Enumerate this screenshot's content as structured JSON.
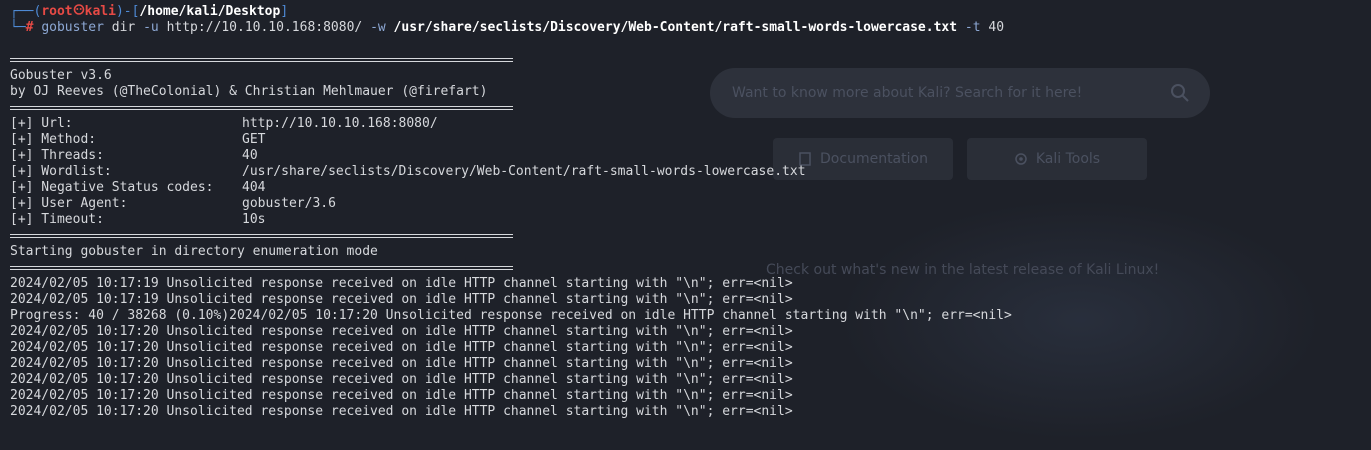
{
  "background": {
    "search_placeholder": "Want to know more about Kali? Search for it here!",
    "docs_button": "Documentation",
    "tools_button": "Kali Tools",
    "tagline": "Check out what's new in the latest release of Kali Linux!"
  },
  "prompt": {
    "user": "root",
    "host": "kali",
    "path": "/home/kali/Desktop",
    "symbol": "#"
  },
  "command": {
    "program": "gobuster",
    "subcommand": "dir",
    "flag_u": "-u",
    "url": "http://10.10.10.168:8080/",
    "flag_w": "-w",
    "wordlist": "/usr/share/seclists/Discovery/Web-Content/raft-small-words-lowercase.txt",
    "flag_t": "-t",
    "threads": "40"
  },
  "banner": {
    "version": "Gobuster v3.6",
    "authors": "by OJ Reeves (@TheColonial) & Christian Mehlmauer (@firefart)"
  },
  "config": [
    {
      "key": "[+] Url:",
      "value": "http://10.10.10.168:8080/"
    },
    {
      "key": "[+] Method:",
      "value": "GET"
    },
    {
      "key": "[+] Threads:",
      "value": "40"
    },
    {
      "key": "[+] Wordlist:",
      "value": "/usr/share/seclists/Discovery/Web-Content/raft-small-words-lowercase.txt"
    },
    {
      "key": "[+] Negative Status codes:",
      "value": "404"
    },
    {
      "key": "[+] User Agent:",
      "value": "gobuster/3.6"
    },
    {
      "key": "[+] Timeout:",
      "value": "10s"
    }
  ],
  "mode_line": "Starting gobuster in directory enumeration mode",
  "output": [
    "2024/02/05 10:17:19 Unsolicited response received on idle HTTP channel starting with \"\\n\"; err=<nil>",
    "2024/02/05 10:17:19 Unsolicited response received on idle HTTP channel starting with \"\\n\"; err=<nil>",
    "Progress: 40 / 38268 (0.10%)2024/02/05 10:17:20 Unsolicited response received on idle HTTP channel starting with \"\\n\"; err=<nil>",
    "2024/02/05 10:17:20 Unsolicited response received on idle HTTP channel starting with \"\\n\"; err=<nil>",
    "2024/02/05 10:17:20 Unsolicited response received on idle HTTP channel starting with \"\\n\"; err=<nil>",
    "2024/02/05 10:17:20 Unsolicited response received on idle HTTP channel starting with \"\\n\"; err=<nil>",
    "2024/02/05 10:17:20 Unsolicited response received on idle HTTP channel starting with \"\\n\"; err=<nil>",
    "2024/02/05 10:17:20 Unsolicited response received on idle HTTP channel starting with \"\\n\"; err=<nil>",
    "2024/02/05 10:17:20 Unsolicited response received on idle HTTP channel starting with \"\\n\"; err=<nil>"
  ]
}
